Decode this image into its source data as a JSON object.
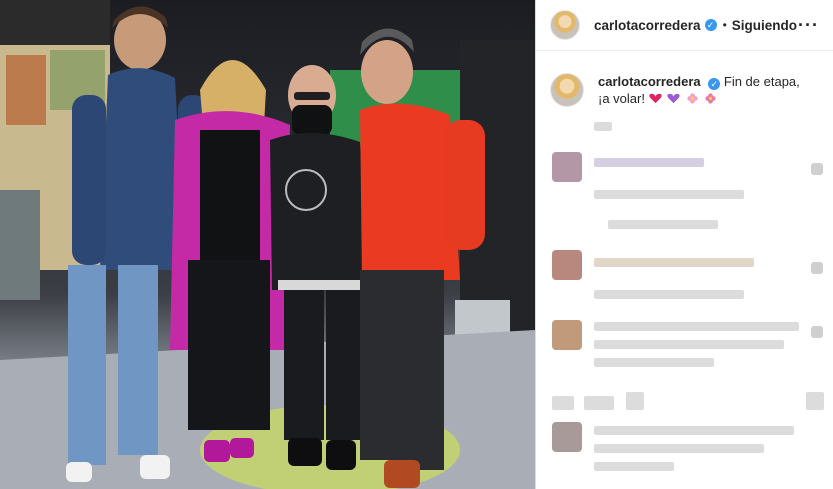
{
  "post": {
    "username": "carlotacorredera",
    "verified_glyph": "✓",
    "separator": "•",
    "follow_status": "Siguiendo",
    "more_glyph": "···"
  },
  "caption": {
    "username": "carlotacorredera",
    "text": "Fin de etapa, ¡a volar!",
    "emojis": [
      "heart-red",
      "heart-purple",
      "flower-pink",
      "flower-pink"
    ]
  },
  "colors": {
    "verified": "#3897f0",
    "text": "#262626",
    "divider": "#dbdbdb"
  }
}
